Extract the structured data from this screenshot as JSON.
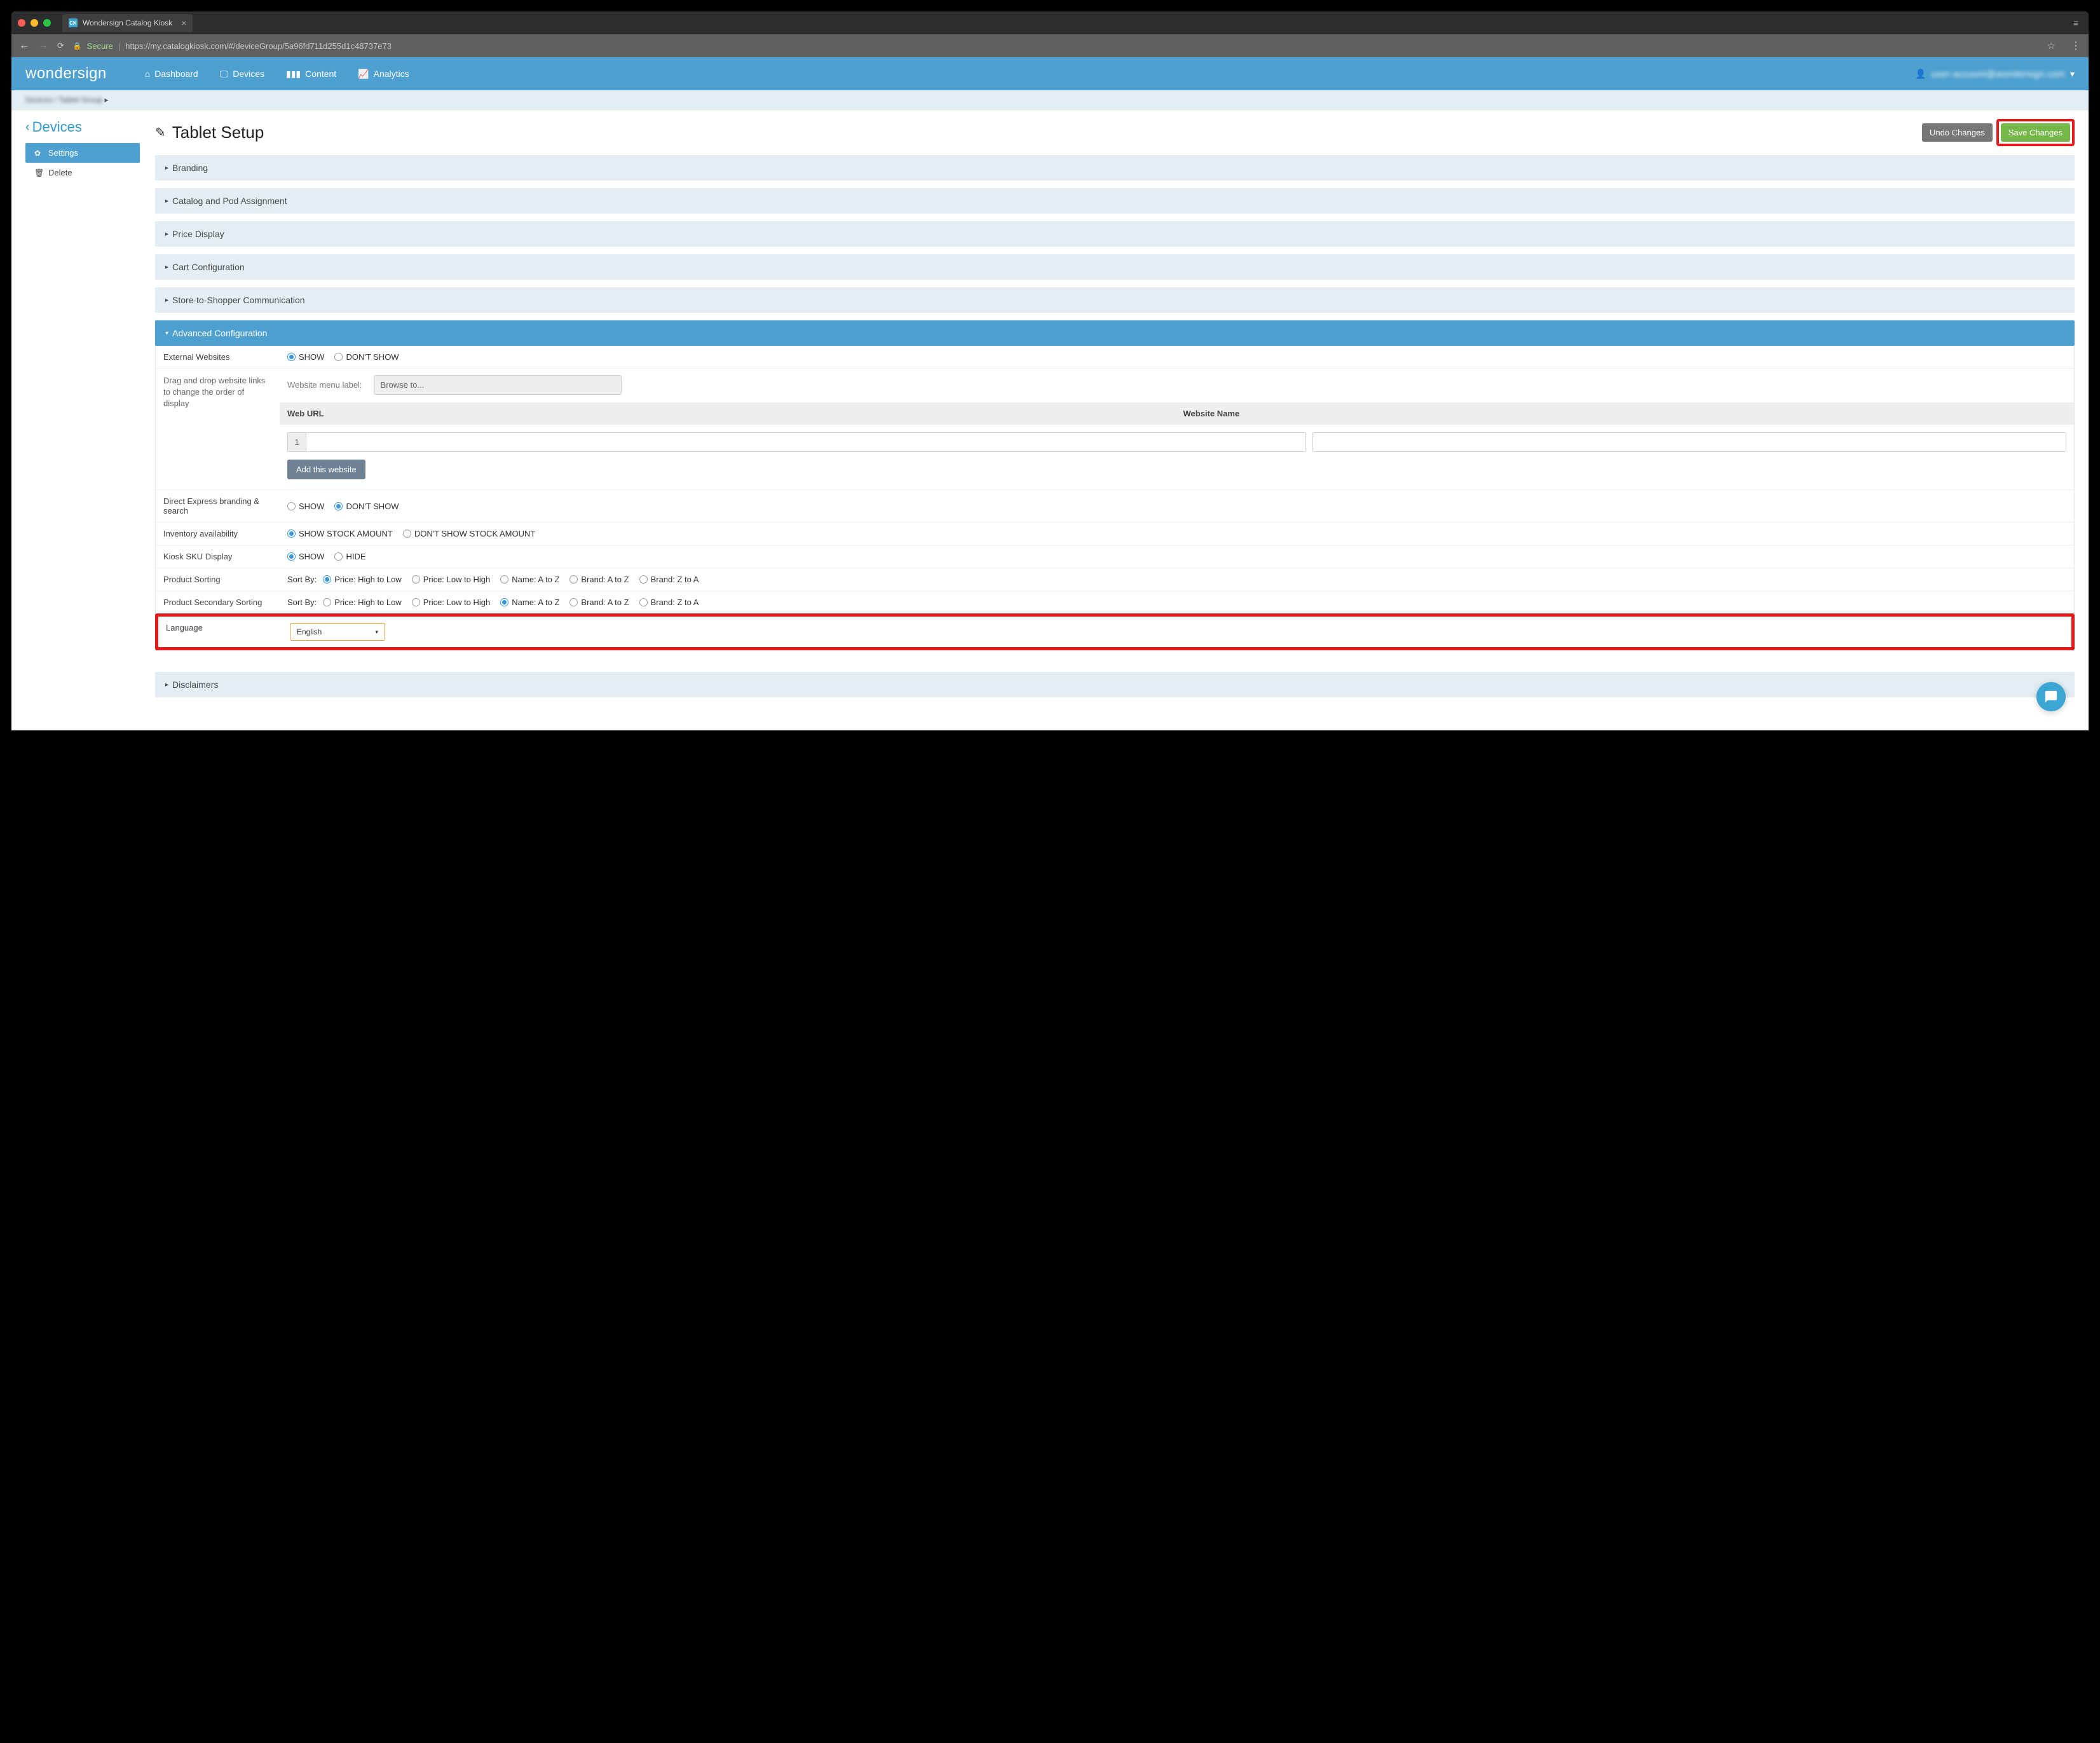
{
  "browser": {
    "tab_title": "Wondersign Catalog Kiosk",
    "url_secure": "Secure",
    "url": "https://my.catalogkiosk.com/#/deviceGroup/5a96fd711d255d1c48737e73"
  },
  "header": {
    "brand": "wondersign",
    "nav": [
      "Dashboard",
      "Devices",
      "Content",
      "Analytics"
    ],
    "user_label": "user-account@wondersign.com"
  },
  "breadcrumbs": {
    "path": "Devices / Tablet Group"
  },
  "sidebar": {
    "back_label": "Devices",
    "items": [
      {
        "label": "Settings",
        "icon": "gear"
      },
      {
        "label": "Delete",
        "icon": "trash"
      }
    ]
  },
  "page": {
    "title": "Tablet Setup",
    "undo_btn": "Undo Changes",
    "save_btn": "Save Changes"
  },
  "panels": {
    "branding": "Branding",
    "catalog": "Catalog and Pod Assignment",
    "price": "Price Display",
    "cart": "Cart Configuration",
    "store_comm": "Store-to-Shopper Communication",
    "advanced": "Advanced Configuration",
    "disclaimers": "Disclaimers"
  },
  "advanced": {
    "external_websites": {
      "label": "External Websites",
      "options": [
        "SHOW",
        "DON'T SHOW"
      ],
      "selected": "SHOW"
    },
    "drag_drop_hint": "Drag and drop website links to change the order of display",
    "menu_label_text": "Website menu label:",
    "menu_label_value": "Browse to...",
    "table_headers": {
      "url": "Web URL",
      "name": "Website Name"
    },
    "row_index": "1",
    "add_website_btn": "Add this website",
    "direct_express": {
      "label": "Direct Express branding & search",
      "options": [
        "SHOW",
        "DON'T SHOW"
      ],
      "selected": "DON'T SHOW"
    },
    "inventory": {
      "label": "Inventory availability",
      "options": [
        "SHOW STOCK AMOUNT",
        "DON'T SHOW STOCK AMOUNT"
      ],
      "selected": "SHOW STOCK AMOUNT"
    },
    "sku": {
      "label": "Kiosk SKU Display",
      "options": [
        "SHOW",
        "HIDE"
      ],
      "selected": "SHOW"
    },
    "sort": {
      "label": "Product Sorting",
      "prefix": "Sort By:",
      "options": [
        "Price: High to Low",
        "Price: Low to High",
        "Name: A to Z",
        "Brand: A to Z",
        "Brand: Z to A"
      ],
      "selected": "Price: High to Low"
    },
    "sort2": {
      "label": "Product Secondary Sorting",
      "prefix": "Sort By:",
      "options": [
        "Price: High to Low",
        "Price: Low to High",
        "Name: A to Z",
        "Brand: A to Z",
        "Brand: Z to A"
      ],
      "selected": "Name: A to Z"
    },
    "language": {
      "label": "Language",
      "value": "English"
    }
  }
}
